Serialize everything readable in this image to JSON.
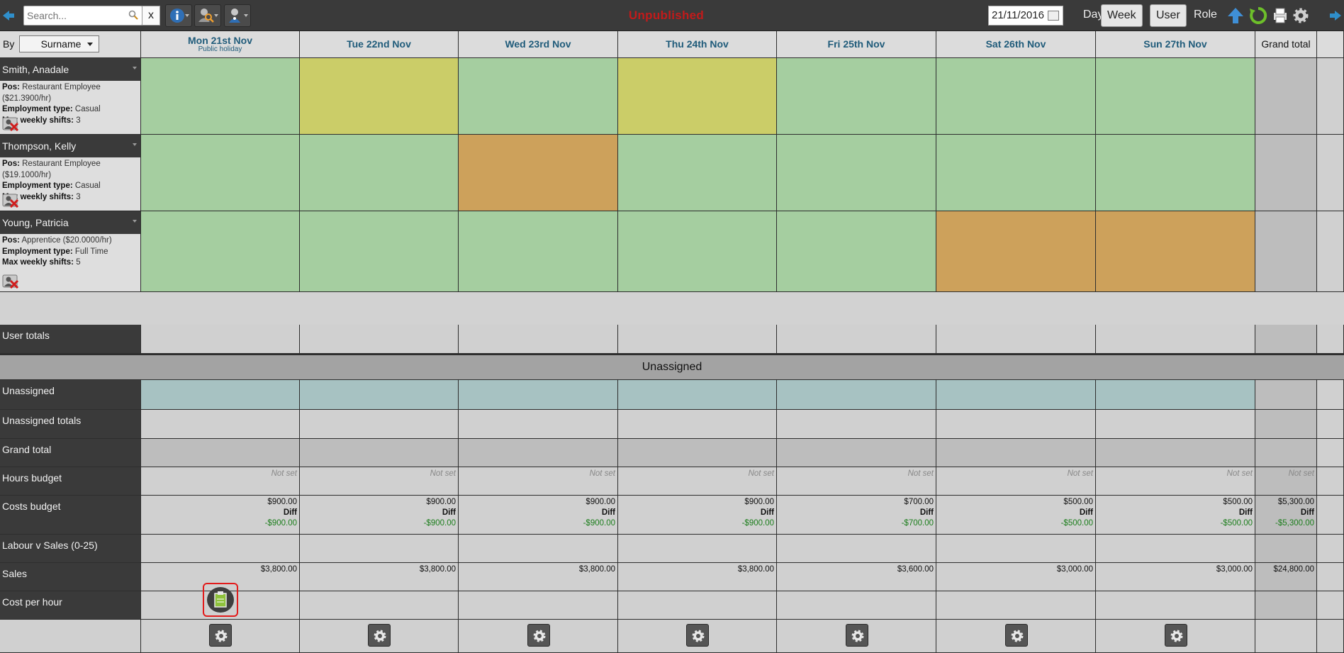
{
  "toolbar": {
    "search_placeholder": "Search...",
    "clear_label": "x",
    "status": "Unpublished",
    "date": "21/11/2016",
    "view_day": "Day",
    "view_week": "Week",
    "group_user": "User",
    "group_role": "Role"
  },
  "sort": {
    "by_label": "By",
    "selected": "Surname"
  },
  "days": [
    {
      "name": "Mon 21st Nov",
      "sub": "Public holiday"
    },
    {
      "name": "Tue 22nd Nov",
      "sub": ""
    },
    {
      "name": "Wed 23rd Nov",
      "sub": ""
    },
    {
      "name": "Thu 24th Nov",
      "sub": ""
    },
    {
      "name": "Fri 25th Nov",
      "sub": ""
    },
    {
      "name": "Sat 26th Nov",
      "sub": ""
    },
    {
      "name": "Sun 27th Nov",
      "sub": ""
    }
  ],
  "grand_total_header": "Grand total",
  "users": [
    {
      "name": "Smith, Anadale",
      "pos_label": "Pos:",
      "pos": "Restaurant Employee ($21.3900/hr)",
      "emp_label": "Employment type:",
      "emp": "Casual",
      "max_label": "Max weekly shifts:",
      "max": "3",
      "cells": [
        "green",
        "yellow",
        "green",
        "yellow",
        "green",
        "green",
        "green"
      ]
    },
    {
      "name": "Thompson, Kelly",
      "pos_label": "Pos:",
      "pos": "Restaurant Employee ($19.1000/hr)",
      "emp_label": "Employment type:",
      "emp": "Casual",
      "max_label": "Max weekly shifts:",
      "max": "3",
      "cells": [
        "green",
        "green",
        "orange",
        "green",
        "green",
        "green",
        "green"
      ]
    },
    {
      "name": "Young, Patricia",
      "pos_label": "Pos:",
      "pos": "Apprentice ($20.0000/hr)",
      "emp_label": "Employment type:",
      "emp": "Full Time",
      "max_label": "Max weekly shifts:",
      "max": "5",
      "cells": [
        "green",
        "green",
        "green",
        "green",
        "green",
        "orange",
        "orange"
      ]
    }
  ],
  "rows": {
    "user_totals": "User totals",
    "unassigned_section": "Unassigned",
    "unassigned": "Unassigned",
    "unassigned_totals": "Unassigned totals",
    "grand_total": "Grand total",
    "hours_budget": "Hours budget",
    "costs_budget": "Costs budget",
    "labour_v_sales": "Labour v Sales (0-25)",
    "sales": "Sales",
    "cost_per_hour": "Cost per hour"
  },
  "hours_budget": {
    "values": [
      "Not set",
      "Not set",
      "Not set",
      "Not set",
      "Not set",
      "Not set",
      "Not set"
    ],
    "total": "Not set"
  },
  "costs_budget": {
    "diff_label": "Diff",
    "values": [
      "$900.00",
      "$900.00",
      "$900.00",
      "$900.00",
      "$700.00",
      "$500.00",
      "$500.00"
    ],
    "diffs": [
      "-$900.00",
      "-$900.00",
      "-$900.00",
      "-$900.00",
      "-$700.00",
      "-$500.00",
      "-$500.00"
    ],
    "total": "$5,300.00",
    "total_diff": "-$5,300.00"
  },
  "sales": {
    "values": [
      "$3,800.00",
      "$3,800.00",
      "$3,800.00",
      "$3,800.00",
      "$3,600.00",
      "$3,000.00",
      "$3,000.00"
    ],
    "total": "$24,800.00"
  },
  "colors": {
    "green": "#a5cea0",
    "yellow": "#cbcd68",
    "orange": "#cda15b",
    "unassigned": "#a7c2c2",
    "status": "#c21a1a",
    "header_text": "#1f5b7a"
  },
  "icons": [
    "prev-arrow-icon",
    "magnifier-icon",
    "info-icon",
    "search-user-icon",
    "user-filter-icon",
    "calendar-icon",
    "upload-icon",
    "refresh-icon",
    "print-icon",
    "gear-icon",
    "next-arrow-icon",
    "delete-user-icon",
    "notes-icon"
  ]
}
